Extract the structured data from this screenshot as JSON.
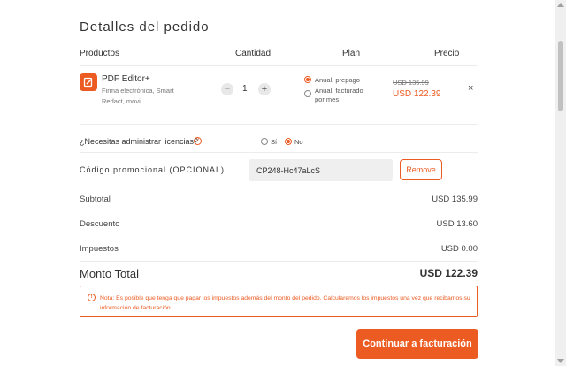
{
  "order": {
    "title": "Detalles del pedido",
    "headers": {
      "products": "Productos",
      "quantity": "Cantidad",
      "plan": "Plan",
      "price": "Precio"
    },
    "product": {
      "icon": "pdf-editor-icon",
      "name": "PDF Editor+",
      "description": "Firma electrónica, Smart Redact, móvil",
      "quantity": "1",
      "minus": "−",
      "plus": "+",
      "plans": [
        {
          "label": "Anual, prepago",
          "selected": true
        },
        {
          "label": "Anual, facturado por mes",
          "selected": false
        }
      ],
      "old_price": "USD 135.99",
      "new_price": "USD 122.39",
      "remove_symbol": "×"
    },
    "licenses": {
      "question": "¿Necesitas administrar licencias?",
      "help_symbol": "?",
      "options": [
        {
          "label": "Sí",
          "selected": false
        },
        {
          "label": "No",
          "selected": true
        }
      ]
    },
    "promo": {
      "label": "Código promocional (OPCIONAL)",
      "value": "CP248-Hc47aLcS",
      "remove_label": "Remove"
    },
    "summary": [
      {
        "label": "Subtotal",
        "value": "USD 135.99"
      },
      {
        "label": "Descuento",
        "value": "USD 13.60"
      },
      {
        "label": "Impuestos",
        "value": "USD 0.00"
      }
    ],
    "total": {
      "label": "Monto Total",
      "value": "USD 122.39"
    },
    "note": {
      "icon_symbol": "!",
      "text": "Nota: Es posible que tenga que pagar los impuestos además del monto del pedido. Calcularemos los impuestos una vez que recibamos su información de facturación."
    },
    "cta_label": "Continuar a facturación"
  },
  "colors": {
    "accent": "#ec5b22",
    "text": "#333333",
    "muted": "#777777"
  }
}
